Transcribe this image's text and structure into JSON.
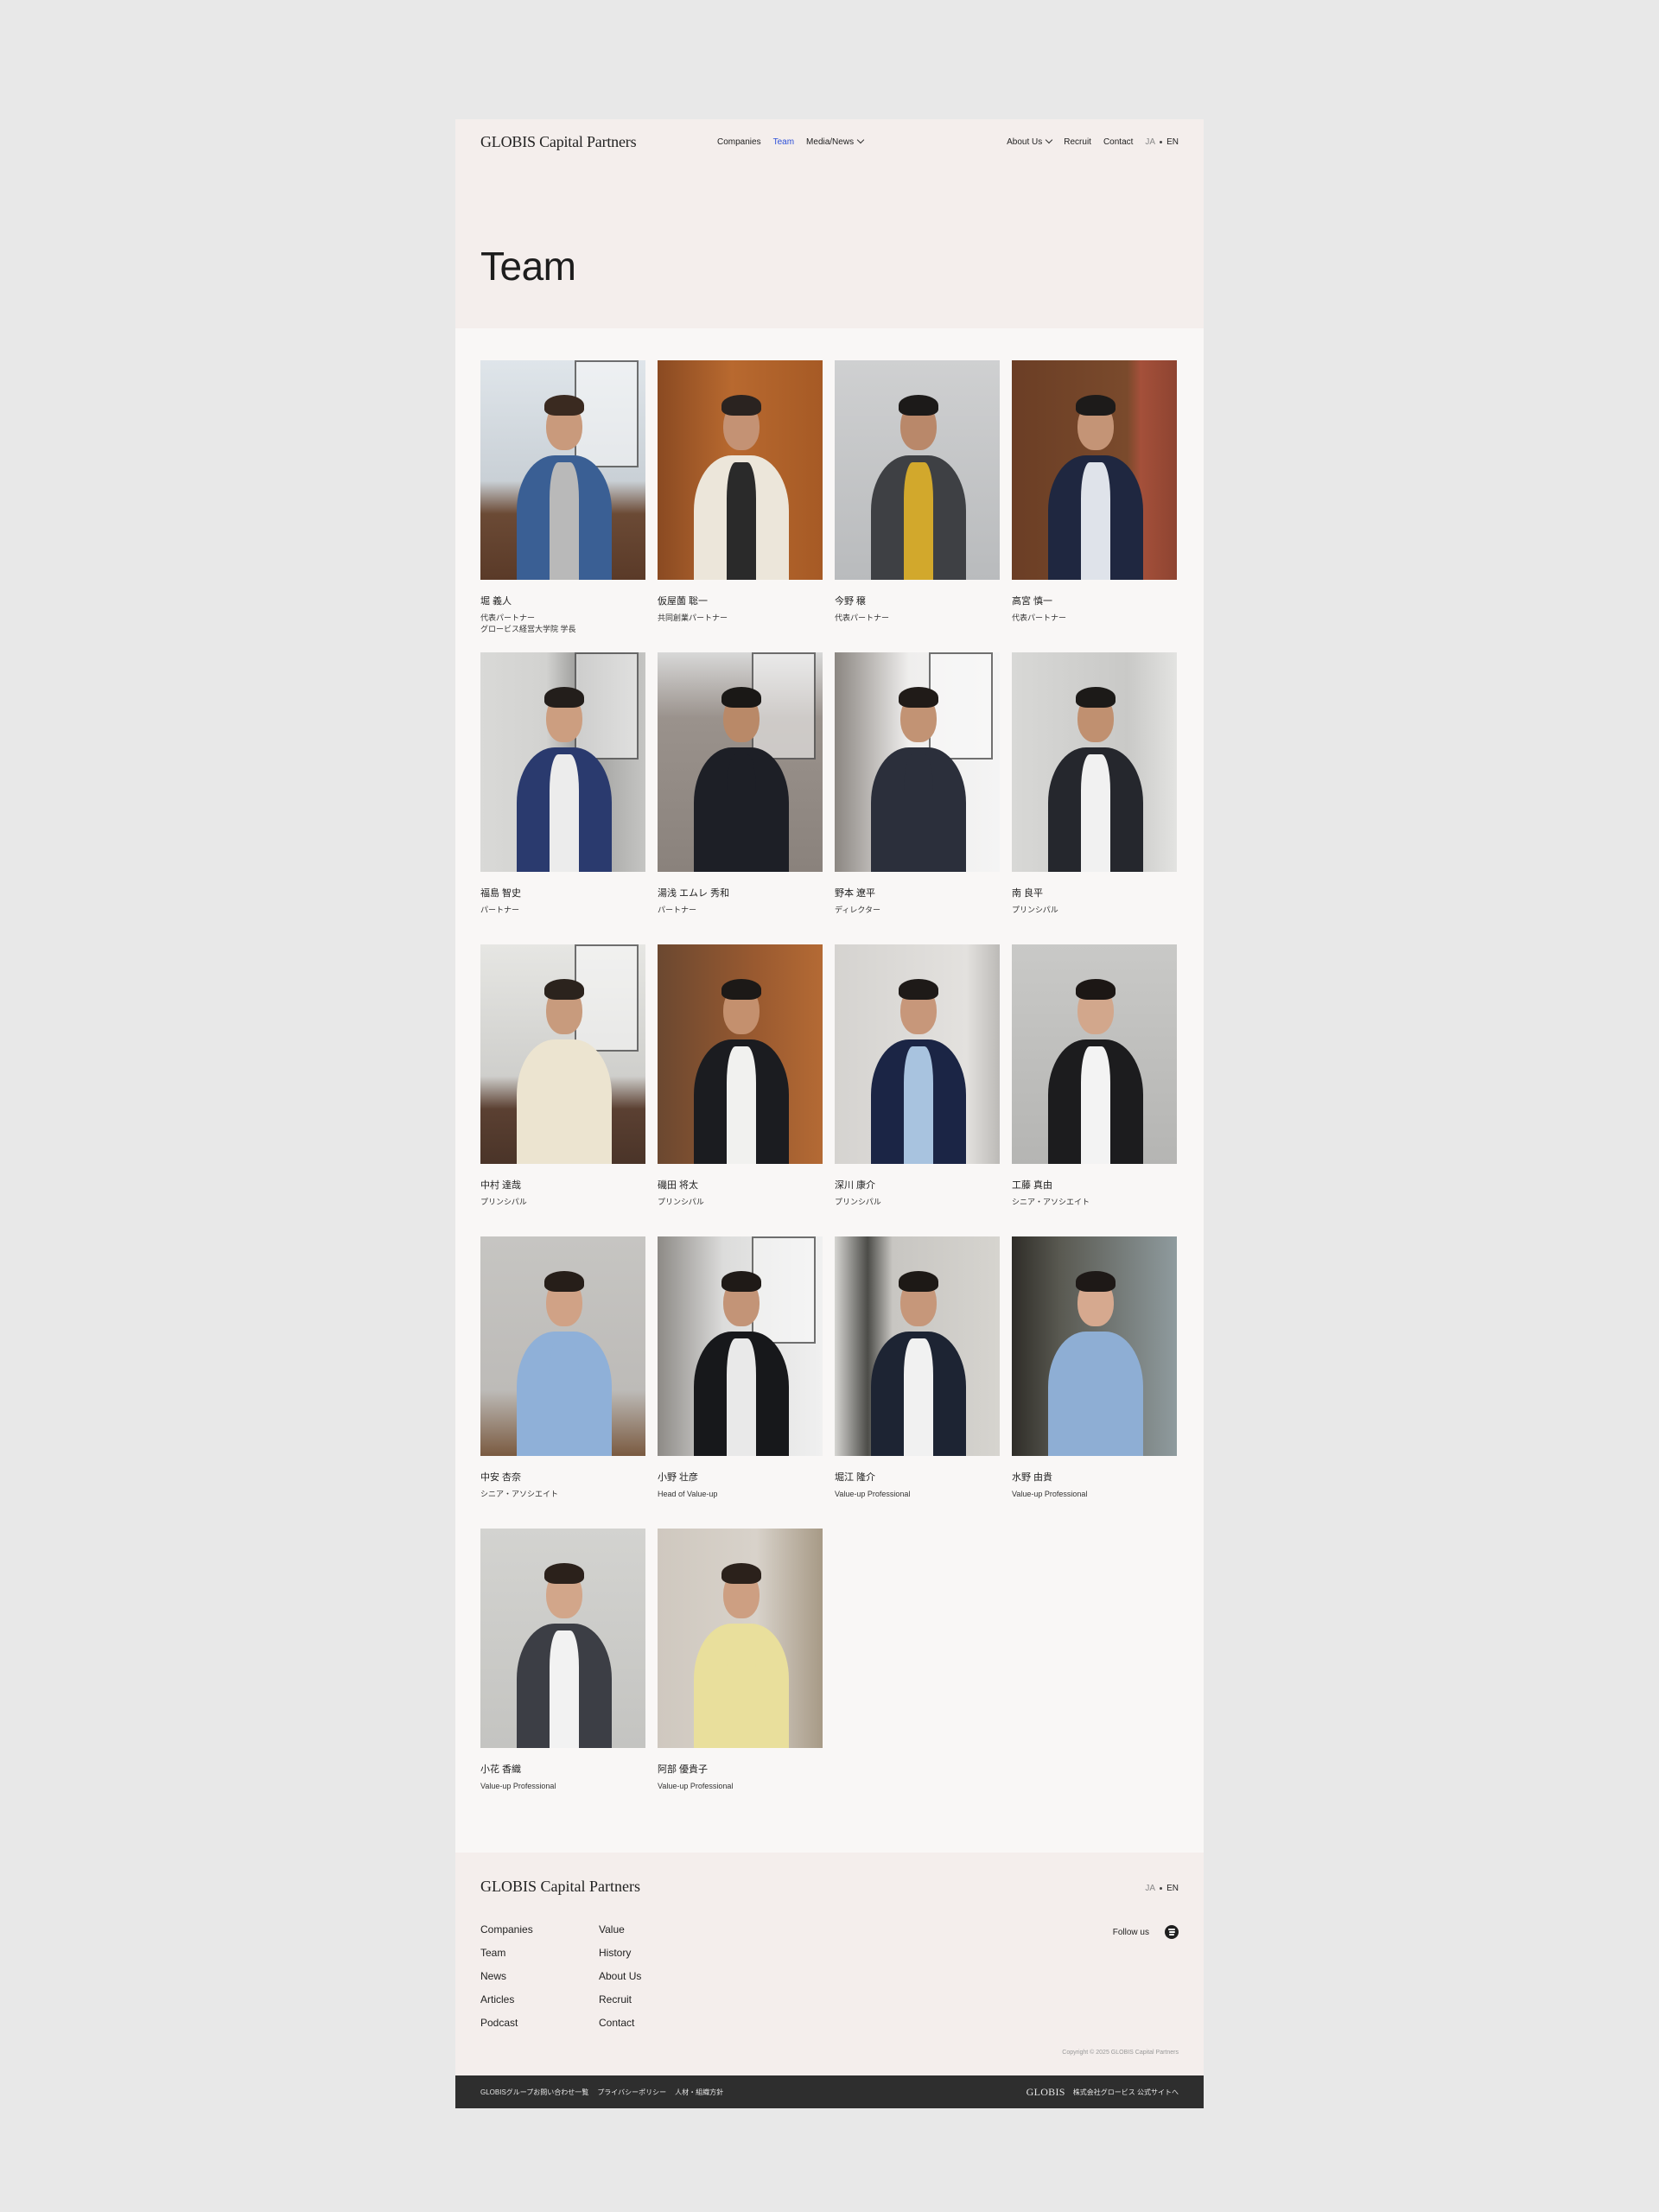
{
  "header": {
    "logo": "GLOBIS Capital Partners",
    "nav_center": [
      "Companies",
      "Team",
      "Media/News"
    ],
    "nav_right": [
      "About Us",
      "Recruit",
      "Contact"
    ],
    "lang": {
      "ja": "JA",
      "en": "EN"
    }
  },
  "hero": {
    "title": "Team"
  },
  "team": [
    {
      "name": "堀 義人",
      "role": "代表パートナー",
      "role2": "グロービス経営大学院 学長"
    },
    {
      "name": "仮屋薗 聡一",
      "role": "共同創業パートナー",
      "role2": ""
    },
    {
      "name": "今野 穣",
      "role": "代表パートナー",
      "role2": ""
    },
    {
      "name": "高宮 慎一",
      "role": "代表パートナー",
      "role2": ""
    },
    {
      "name": "福島 智史",
      "role": "パートナー",
      "role2": ""
    },
    {
      "name": "湯浅 エムレ 秀和",
      "role": "パートナー",
      "role2": ""
    },
    {
      "name": "野本 遼平",
      "role": "ディレクター",
      "role2": ""
    },
    {
      "name": "南 良平",
      "role": "プリンシパル",
      "role2": ""
    },
    {
      "name": "中村 達哉",
      "role": "プリンシパル",
      "role2": ""
    },
    {
      "name": "磯田 将太",
      "role": "プリンシパル",
      "role2": ""
    },
    {
      "name": "深川 康介",
      "role": "プリンシパル",
      "role2": ""
    },
    {
      "name": "工藤 真由",
      "role": "シニア・アソシエイト",
      "role2": ""
    },
    {
      "name": "中安 杏奈",
      "role": "シニア・アソシエイト",
      "role2": ""
    },
    {
      "name": "小野 壮彦",
      "role": "Head of Value-up",
      "role2": ""
    },
    {
      "name": "堀江 隆介",
      "role": "Value-up Professional",
      "role2": ""
    },
    {
      "name": "水野 由貴",
      "role": "Value-up Professional",
      "role2": ""
    },
    {
      "name": "小花 香織",
      "role": "Value-up Professional",
      "role2": ""
    },
    {
      "name": "阿部 優貴子",
      "role": "Value-up Professional",
      "role2": ""
    }
  ],
  "footer": {
    "logo": "GLOBIS Capital Partners",
    "lang": {
      "ja": "JA",
      "en": "EN"
    },
    "col1": [
      "Companies",
      "Team",
      "News",
      "Articles",
      "Podcast"
    ],
    "col2": [
      "Value",
      "History",
      "About Us",
      "Recruit",
      "Contact"
    ],
    "follow": "Follow us",
    "copyright": "Copyright © 2025 GLOBIS Capital Partners"
  },
  "bottom_bar": {
    "links": [
      "GLOBISグループお問い合わせ一覧",
      "プライバシーポリシー",
      "人材・組織方針"
    ],
    "logo": "GLOBIS",
    "corporate": "株式会社グロービス 公式サイトへ"
  },
  "colors": {
    "accent": "#2b4fd8",
    "hero_bg": "#f4eeec",
    "body_bg": "#f9f7f6",
    "bar_bg": "#2e2e2e"
  },
  "icons": [
    "chevron-down-icon",
    "spotify-icon"
  ]
}
